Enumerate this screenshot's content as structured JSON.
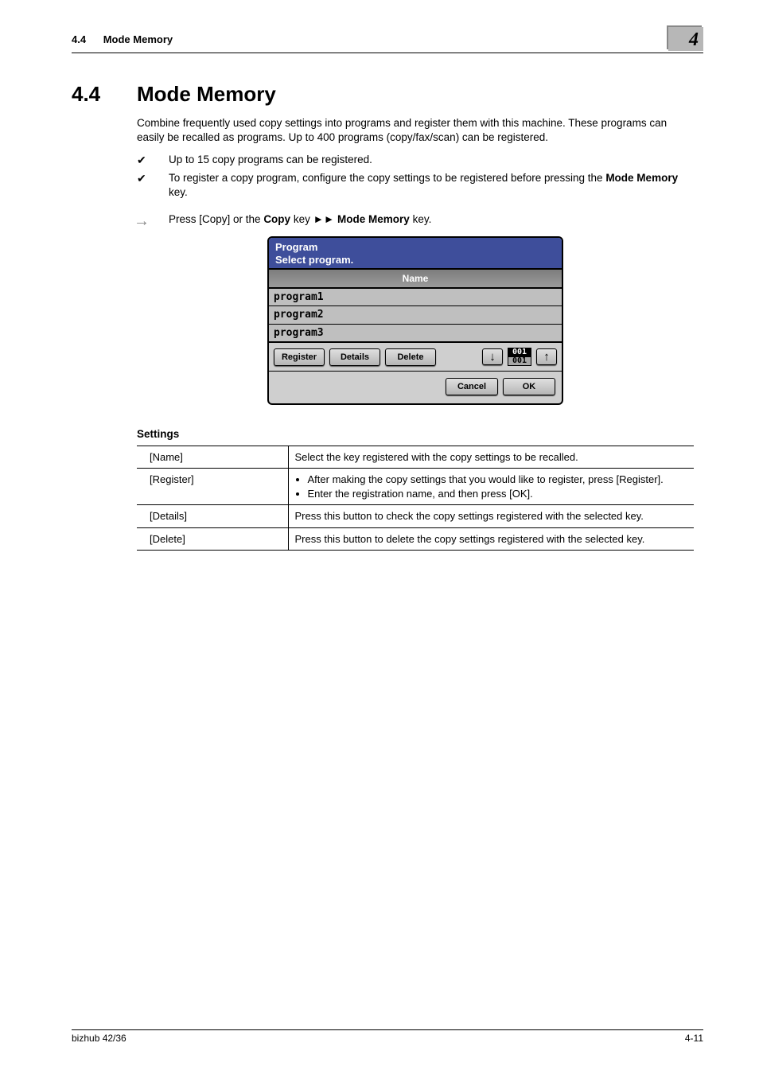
{
  "header": {
    "section_num": "4.4",
    "section_name": "Mode Memory",
    "chapter_num": "4"
  },
  "heading": {
    "num": "4.4",
    "title": "Mode Memory"
  },
  "intro": "Combine frequently used copy settings into programs and register them with this machine. These programs can easily be recalled as programs. Up to 400 programs (copy/fax/scan) can be registered.",
  "checks": [
    "Up to 15 copy programs can be registered.",
    "To register a copy program, configure the copy settings to be registered before pressing the "
  ],
  "check2_bold": "Mode Memory",
  "check2_tail": " key.",
  "arrow": {
    "p1": "Press [Copy] or the ",
    "b1": "Copy",
    "p2": " key ►► ",
    "b2": "Mode Memory",
    "p3": " key."
  },
  "lcd": {
    "title1": "Program",
    "title2": "Select program.",
    "name_header": "Name",
    "rows": [
      "program1",
      "program2",
      "program3"
    ],
    "btns": {
      "register": "Register",
      "details": "Details",
      "delete": "Delete",
      "down": "↓",
      "up": "↑",
      "page_top": "001",
      "page_bot": "001"
    },
    "footer": {
      "cancel": "Cancel",
      "ok": "OK"
    }
  },
  "settings_title": "Settings",
  "settings": [
    {
      "k": "[Name]",
      "plain": "Select the key registered with the copy settings to be recalled."
    },
    {
      "k": "[Register]",
      "bullets": [
        "After making the copy settings that you would like to register, press [Register].",
        "Enter the registration name, and then press [OK]."
      ]
    },
    {
      "k": "[Details]",
      "plain": "Press this button to check the copy settings registered with the selected key."
    },
    {
      "k": "[Delete]",
      "plain": "Press this button to delete the copy settings registered with the selected key."
    }
  ],
  "footer": {
    "left": "bizhub 42/36",
    "right": "4-11"
  }
}
